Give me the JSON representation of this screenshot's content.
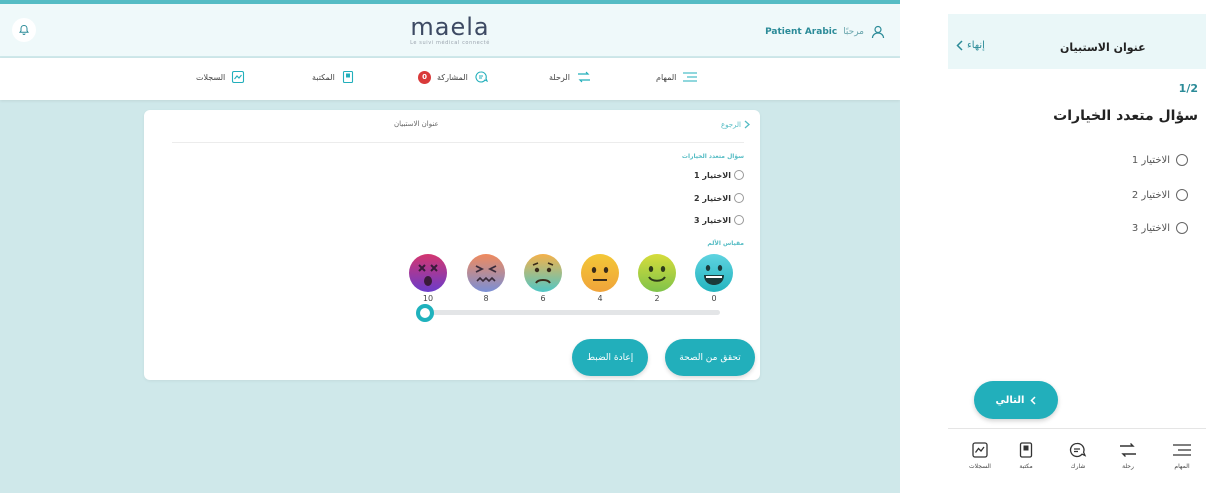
{
  "desktop": {
    "logo": {
      "word": "maela",
      "tagline": "Le suivi médical connecté"
    },
    "user": {
      "greeting": "مرحبًا",
      "name": "Patient Arabic"
    },
    "nav": {
      "tasks": "المهام",
      "journey": "الرحلة",
      "share": "المشاركة",
      "share_badge": "0",
      "library": "المكتبة",
      "records": "السجلات"
    },
    "card": {
      "back_label": "الرجوع",
      "title": "عنوان الاستبيان",
      "question_title": "سؤال متعدد الخيارات",
      "options": [
        "الاختيار 1",
        "الاختيار 2",
        "الاختيار 3"
      ],
      "scale_title": "مقياس الألم",
      "scale_values": [
        "10",
        "8",
        "6",
        "4",
        "2",
        "0"
      ],
      "slider_value": 10,
      "verify_label": "تحقق من الصحة",
      "reset_label": "إعادة الضبط"
    }
  },
  "mobile": {
    "back_label": "إنهاء",
    "title": "عنوان الاستبيان",
    "page_indicator": "1/2",
    "question": "سؤال متعدد الخيارات",
    "options": [
      "الاختيار 1",
      "الاختيار 2",
      "الاختيار 3"
    ],
    "next_label": "التالي",
    "tabs": {
      "records": "السجلات",
      "library": "مكتبة",
      "share": "شارك",
      "journey": "رحلة",
      "tasks": "المهام"
    }
  },
  "colors": {
    "accent": "#22afbb",
    "background": "#cfe8ea",
    "badge": "#d93a3a",
    "header": "#eff9fa"
  }
}
